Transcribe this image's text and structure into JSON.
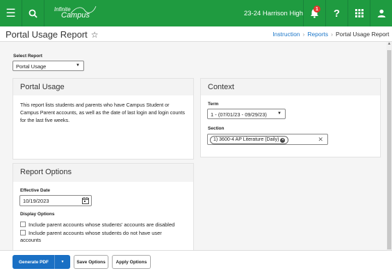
{
  "topbar": {
    "logo_line1": "Infinite",
    "logo_line2": "Campus",
    "school": "23-24 Harrison High",
    "notification_count": "1",
    "icons": [
      "menu-icon",
      "search-icon",
      "bell-icon",
      "help-icon",
      "apps-grid-icon",
      "user-icon"
    ],
    "color": "#1f9b40"
  },
  "titlebar": {
    "title": "Portal Usage Report",
    "breadcrumb": [
      "Instruction",
      "Reports",
      "Portal Usage Report"
    ]
  },
  "select_report": {
    "label": "Select Report",
    "value": "Portal Usage"
  },
  "portal_card": {
    "title": "Portal Usage",
    "description": "This report lists students and parents who have Campus Student or Campus Parent accounts, as well as the date of last login and login counts for the last five weeks."
  },
  "context_card": {
    "title": "Context",
    "term_label": "Term",
    "term_value": "1 - (07/01/23 - 09/29/23)",
    "section_label": "Section",
    "section_chip": "1) 3600-4 AP Literature (Daily)"
  },
  "options_card": {
    "title": "Report Options",
    "date_label": "Effective Date",
    "date_value": "10/19/2023",
    "display_label": "Display Options",
    "option1": "Include parent accounts whose students' accounts are disabled",
    "option2a": "Include parent accounts whose students do not have user",
    "option2b": "accounts"
  },
  "footer": {
    "generate": "Generate PDF",
    "save": "Save Options",
    "apply": "Apply Options",
    "primary_color": "#1a70c4"
  }
}
